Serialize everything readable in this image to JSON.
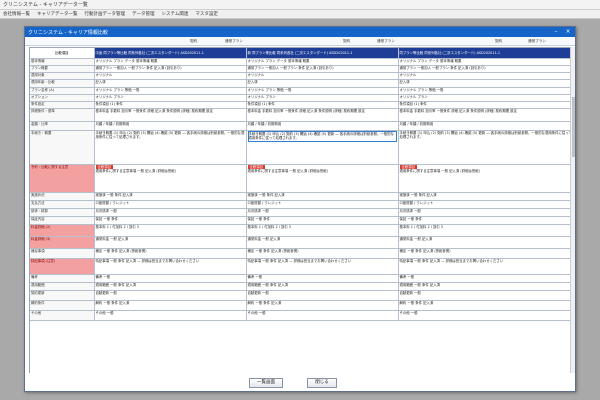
{
  "app": {
    "title": "クリニシステム - キャリアデーター覧",
    "menu": [
      "会社情報一覧",
      "キャリアデーター覧",
      "行動計画データ管理",
      "データ管理",
      "システム関連",
      "マスタ設定"
    ]
  },
  "dialog": {
    "title": "クリニシステム - キャリア情報比較",
    "top_labels": [
      "契約",
      "通常プラン",
      "契約",
      "通常プラン",
      "契約",
      "通常プラン"
    ],
    "buttons": {
      "prev": "一覧画面",
      "close": "閉じる"
    }
  },
  "table": {
    "corner": "比較項目",
    "columns": [
      "中途 同プラン等比較 同系列各社 (二次エスタンダード) ASD202011-1",
      "新 同プラン等比較 同系列各社 (二次エスタンダード) ASD202011-1",
      "同プラン等比較 同系列各社 (二次エスタンダード) ASD202011-1"
    ],
    "rows": [
      {
        "label": "基本情報",
        "cells": [
          "オリジナル プラン データ 基本情報 概要",
          "オリジナル プラン データ 基本情報 概要",
          "オリジナル プラン データ 基本情報 概要"
        ]
      },
      {
        "label": "プラン概要",
        "cells": [
          "通常プラン 一般加入 一般プラン 条件 記入済 (割引あり)",
          "通常プラン 一般加入 一般プラン 条件 記入済 (割引あり)",
          "通常プラン 一般加入 一般プラン 条件 記入済 (割引あり)"
        ]
      },
      {
        "label": "適用対象",
        "cells": [
          "オリジナル",
          "オリジナル",
          "オリジナル"
        ]
      },
      {
        "label": "適用年齢・比較",
        "cells": [
          "記入済",
          "記入済",
          "記入済"
        ]
      },
      {
        "label": "プラン名称 (A)",
        "cells": [
          "オリジナル プラン 等価 一般",
          "オリジナル プラン 等価 一般",
          "オリジナル プラン 等価 一般"
        ]
      },
      {
        "label": "オプション",
        "cells": [
          "オリジナル プラン",
          "オリジナル プラン",
          "オリジナル プラン"
        ]
      },
      {
        "label": "条件設定",
        "cells": [
          "条件項目 (1) 条件",
          "条件項目 (1) 条件",
          "条件項目 (1) 条件"
        ]
      },
      {
        "label": "詳細条件・基準",
        "cells": [
          "基本料金 手数料 割引率 一般条件 詳細 記入済 条件説明 (詳細) 契約期間 設定",
          "基本料金 手数料 割引率 一般条件 詳細 記入済 条件説明 (詳細) 契約期間 設定",
          "基本料金 手数料 割引率 一般条件 詳細 記入済 条件説明 (詳細) 契約期間 設定"
        ]
      },
      {
        "label": "金額・比率",
        "cells": [
          "月額 / 年額 / 初期費用",
          "月額 / 年額 / 初期費用",
          "月額 / 年額 / 初期費用"
        ]
      },
      {
        "label": "手続き・概要",
        "cells": [
          "手続き概要 (1) 申込 (2) 契約 (3) 開始 (4) 確認 (5) 更新 — 各手続の詳細は別紙参照。一般的な適用条件に従って処理されます。",
          "手続き概要 (1) 申込 (2) 契約 (3) 開始 (4) 確認 (5) 更新 — 各手続の詳細は別紙参照。一般的な適用条件に従って処理されます。",
          "手続き概要 (1) 申込 (2) 契約 (3) 開始 (4) 確認 (5) 更新 — 各手続の詳細は別紙参照。一般的な適用条件に従って処理されます。"
        ]
      },
      {
        "label": "予約・比較に関する注意",
        "cells": [
          "適用条件に関する注意事項 一般 記入済 (詳細は別紙)",
          "適用条件に関する注意事項 一般 記入済 (詳細は別紙)",
          "適用条件に関する注意事項 一般 記入済 (詳細は別紙)"
        ],
        "highlight": true,
        "chips": [
          "比較項目",
          "比較項目",
          "比較項目"
        ]
      },
      {
        "label": "実施状況",
        "cells": [
          "実施済 一般 条件 記入済",
          "実施済 一般 条件 記入済",
          "実施済 一般 条件 記入済"
        ]
      },
      {
        "label": "支払方法",
        "cells": [
          "口座振替 / クレジット",
          "口座振替 / クレジット",
          "口座振替 / クレジット"
        ]
      },
      {
        "label": "請求・精算",
        "cells": [
          "月次請求 一般",
          "月次請求 一般",
          "月次請求 一般"
        ]
      },
      {
        "label": "保証内容",
        "cells": [
          "保証 一般 条件",
          "保証 一般 条件",
          "保証 一般 条件"
        ]
      },
      {
        "label": "料金詳細 (2)",
        "cells": [
          "基本料 1 / 付加料 2 / 割引 3",
          "基本料 1 / 付加料 2 / 割引 3",
          "基本料 1 / 付加料 2 / 割引 3"
        ],
        "highlight": true
      },
      {
        "label": "料金詳細 (3)",
        "cells": [
          "通常料金 一般 記入済",
          "通常料金 一般 記入済",
          "通常料金 一般 記入済"
        ],
        "highlight": true
      },
      {
        "label": "補足事項",
        "cells": [
          "補足 一般 条件 記入済 (別紙参照)",
          "補足 一般 条件 記入済 (別紙参照)",
          "補足 一般 条件 記入済 (別紙参照)"
        ]
      },
      {
        "label": "特記事項 (注意)",
        "cells": [
          "特記事項 一般 条件 記入済 — 詳細は担当までお問い合わせください",
          "特記事項 一般 条件 記入済 — 詳細は担当までお問い合わせください",
          "特記事項 一般 条件 記入済 — 詳細は担当までお問い合わせください"
        ],
        "highlight": true
      },
      {
        "label": "備考",
        "cells": [
          "備考 一般",
          "備考 一般",
          "備考 一般"
        ]
      },
      {
        "label": "適用範囲",
        "cells": [
          "適用範囲 一般 条件 記入済",
          "適用範囲 一般 条件 記入済",
          "適用範囲 一般 条件 記入済"
        ]
      },
      {
        "label": "契約更新",
        "cells": [
          "自動更新 一般",
          "自動更新 一般",
          "自動更新 一般"
        ]
      },
      {
        "label": "解約条件",
        "cells": [
          "解約 一般 条件 記入済",
          "解約 一般 条件 記入済",
          "解約 一般 条件 記入済"
        ]
      },
      {
        "label": "その他",
        "cells": [
          "その他 一般",
          "その他 一般",
          "その他 一般"
        ]
      }
    ]
  }
}
